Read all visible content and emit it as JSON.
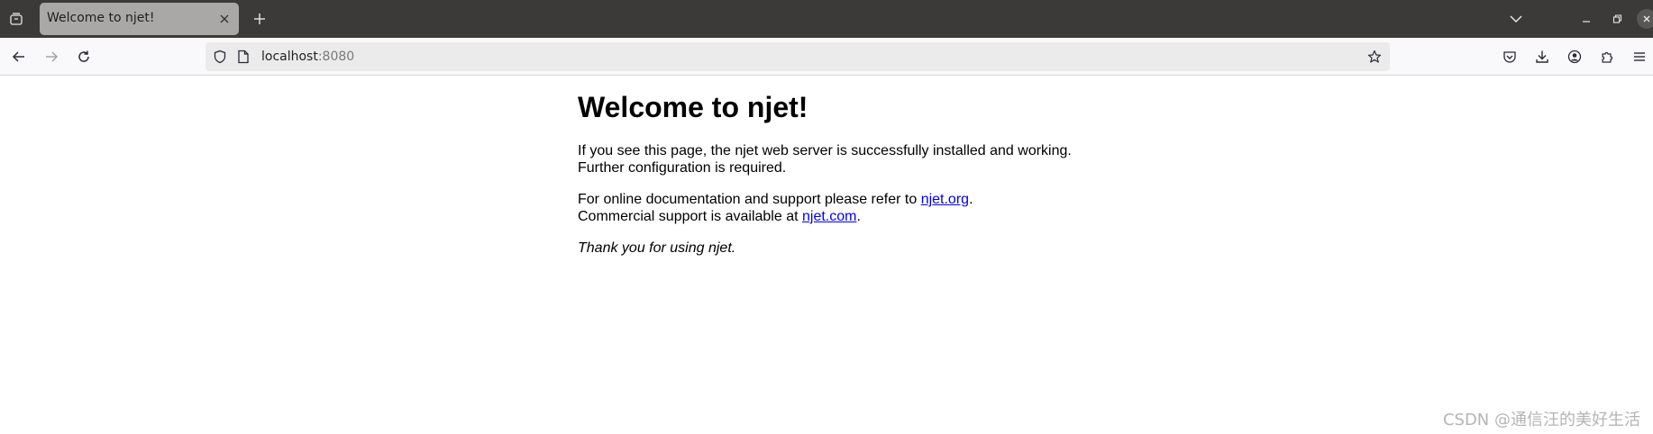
{
  "tab": {
    "title": "Welcome to njet!"
  },
  "urlbar": {
    "host": "localhost",
    "port": ":8080"
  },
  "page": {
    "heading": "Welcome to njet!",
    "p1_line1": "If you see this page, the njet web server is successfully installed and working.",
    "p1_line2": "Further configuration is required.",
    "p2_line1_prefix": "For online documentation and support please refer to ",
    "p2_link1": "njet.org",
    "p2_line1_suffix": ".",
    "p2_line2_prefix": "Commercial support is available at ",
    "p2_link2": "njet.com",
    "p2_line2_suffix": ".",
    "p3": "Thank you for using njet."
  },
  "watermark": "CSDN @通信汪的美好生活",
  "colors": {
    "tabbar_bg": "#3b3a38",
    "active_tab_bg": "#a9a8a6",
    "navbar_bg": "#f9f9fb",
    "urlbar_bg": "#ebebeb",
    "link": "#0000ee"
  },
  "icons": {
    "tab_list": "tab-list-icon",
    "tab_close": "close-icon",
    "new_tab": "plus-icon",
    "tabs_dropdown": "chevron-down-icon",
    "back": "arrow-left-icon",
    "forward": "arrow-right-icon",
    "reload": "reload-icon",
    "shield": "shield-icon",
    "page_info": "page-icon",
    "bookmark": "star-icon",
    "pocket": "pocket-icon",
    "downloads": "download-icon",
    "account": "account-icon",
    "extensions": "puzzle-icon",
    "menu": "hamburger-icon"
  }
}
